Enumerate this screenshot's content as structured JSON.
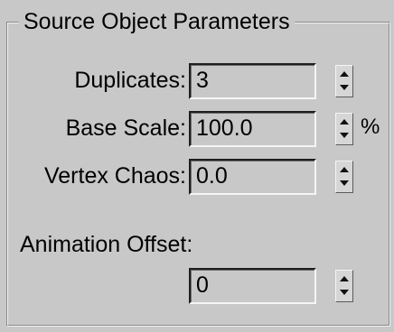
{
  "panel": {
    "title": "Source Object Parameters"
  },
  "params": {
    "duplicates": {
      "label": "Duplicates:",
      "value": "3"
    },
    "base_scale": {
      "label": "Base Scale:",
      "value": "100.0",
      "unit": "%"
    },
    "vertex_chaos": {
      "label": "Vertex Chaos:",
      "value": "0.0"
    },
    "animation_offset": {
      "label": "Animation Offset:",
      "value": "0"
    }
  },
  "colors": {
    "panel_background": "#c8c8c8",
    "field_dark_border": "#1e1e1e",
    "field_light_border": "#f5f5f5"
  },
  "icons": {
    "spinner": "up-down-arrows"
  }
}
